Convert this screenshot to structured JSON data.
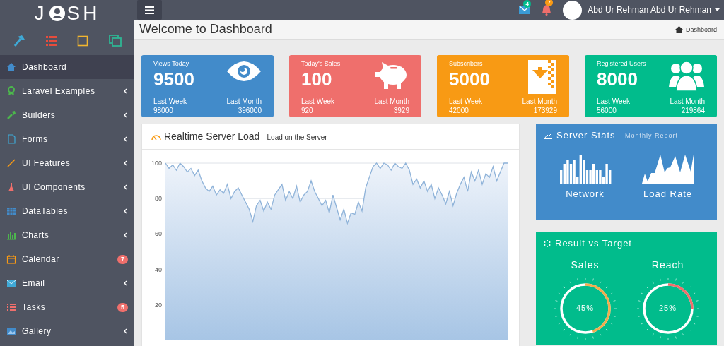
{
  "logo": {
    "left": "J",
    "right": "SH"
  },
  "topbar": {
    "mail_badge": "4",
    "bell_badge": "7",
    "user": "Abd Ur Rehman Abd Ur Rehman"
  },
  "sidebar": {
    "items": [
      {
        "label": "Dashboard",
        "selected": true,
        "submenu": false
      },
      {
        "label": "Laravel Examples",
        "selected": false,
        "submenu": true
      },
      {
        "label": "Builders",
        "selected": false,
        "submenu": true
      },
      {
        "label": "Forms",
        "selected": false,
        "submenu": true
      },
      {
        "label": "UI Features",
        "selected": false,
        "submenu": true
      },
      {
        "label": "UI Components",
        "selected": false,
        "submenu": true
      },
      {
        "label": "DataTables",
        "selected": false,
        "submenu": true
      },
      {
        "label": "Charts",
        "selected": false,
        "submenu": true
      },
      {
        "label": "Calendar",
        "selected": false,
        "submenu": false,
        "badge": "7"
      },
      {
        "label": "Email",
        "selected": false,
        "submenu": true
      },
      {
        "label": "Tasks",
        "selected": false,
        "submenu": false,
        "badge": "5"
      },
      {
        "label": "Gallery",
        "selected": false,
        "submenu": true
      }
    ]
  },
  "page_title": "Welcome to Dashboard",
  "breadcrumb": "Dashboard",
  "stat_cards": [
    {
      "kind": "eye",
      "color": "#428bca",
      "title": "Views Today",
      "value": "9500",
      "week_label": "Last Week",
      "week_value": "98000",
      "month_label": "Last Month",
      "month_value": "396000"
    },
    {
      "kind": "piggy",
      "color": "#ef6f6c",
      "title": "Today's Sales",
      "value": "100",
      "week_label": "Last Week",
      "week_value": "920",
      "month_label": "Last Month",
      "month_value": "3929"
    },
    {
      "kind": "archive",
      "color": "#f89a14",
      "title": "Subscribers",
      "value": "5000",
      "week_label": "Last Week",
      "week_value": "42000",
      "month_label": "Last Month",
      "month_value": "173929"
    },
    {
      "kind": "users",
      "color": "#01bc8c",
      "title": "Registered Users",
      "value": "8000",
      "week_label": "Last Week",
      "week_value": "56000",
      "month_label": "Last Month",
      "month_value": "219864"
    }
  ],
  "server_load": {
    "title": "Realtime Server Load",
    "subtitle": "- Load on the Server",
    "chart_data": {
      "type": "line",
      "ylim": [
        0,
        100
      ],
      "yticks": [
        20,
        40,
        60,
        80,
        100
      ],
      "series": [
        {
          "color": "#8fb3d9",
          "values": [
            100,
            97,
            99,
            96,
            100,
            98,
            95,
            97,
            93,
            96,
            90,
            86,
            84,
            87,
            82,
            85,
            83,
            88,
            80,
            84,
            86,
            82,
            78,
            74,
            67,
            76,
            79,
            73,
            78,
            74,
            82,
            85,
            88,
            79,
            84,
            80,
            87,
            78,
            82,
            84,
            90,
            84,
            80,
            76,
            79,
            72,
            82,
            75,
            68,
            74,
            66,
            72,
            71,
            78,
            73,
            86,
            92,
            98,
            100,
            97,
            100,
            99,
            96,
            100,
            98,
            97,
            100,
            96,
            88,
            91,
            86,
            90,
            84,
            88,
            80,
            86,
            82,
            77,
            84,
            76,
            83,
            88,
            92,
            84,
            95,
            90,
            96,
            88,
            94,
            92,
            98,
            90,
            95,
            100,
            100
          ]
        }
      ]
    }
  },
  "server_stats": {
    "title": "Server Stats",
    "subtitle": "- Monthly Report",
    "labels": [
      "Network",
      "Load Rate"
    ]
  },
  "result_target": {
    "title": "Result vs Target",
    "gauges": [
      {
        "label": "Sales",
        "reading": "45%",
        "level": 0.45,
        "color": "#f0ad4e"
      },
      {
        "label": "Reach",
        "reading": "25%",
        "level": 0.25,
        "color": "#ef6f6c"
      }
    ]
  }
}
